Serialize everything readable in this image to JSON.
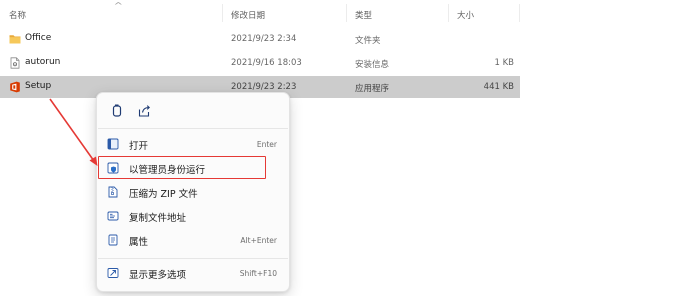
{
  "columns": {
    "name": "名称",
    "date": "修改日期",
    "type": "类型",
    "size": "大小"
  },
  "files": [
    {
      "icon": "folder-icon",
      "name": "Office",
      "date": "2021/9/23 2:34",
      "type": "文件夹",
      "size": ""
    },
    {
      "icon": "file-icon",
      "name": "autorun",
      "date": "2021/9/16 18:03",
      "type": "安装信息",
      "size": "1 KB"
    },
    {
      "icon": "office-app-icon",
      "name": "Setup",
      "date": "2021/9/23 2:23",
      "type": "应用程序",
      "size": "441 KB"
    }
  ],
  "context_menu": {
    "top_actions": [
      {
        "icon": "copy-icon"
      },
      {
        "icon": "share-icon"
      }
    ],
    "items": [
      {
        "icon": "open-icon",
        "label": "打开",
        "shortcut": "Enter"
      },
      {
        "icon": "shield-icon",
        "label": "以管理员身份运行",
        "shortcut": ""
      },
      {
        "icon": "zip-icon",
        "label": "压缩为 ZIP 文件",
        "shortcut": ""
      },
      {
        "icon": "copy-path-icon",
        "label": "复制文件地址",
        "shortcut": ""
      },
      {
        "icon": "properties-icon",
        "label": "属性",
        "shortcut": "Alt+Enter"
      },
      {
        "icon": "more-options-icon",
        "label": "显示更多选项",
        "shortcut": "Shift+F10"
      }
    ]
  },
  "annotation": {
    "color": "#e53935",
    "target": "以管理员身份运行"
  },
  "colors": {
    "selected_row": "#cccccc",
    "folder": "#f4c04e",
    "office_red": "#d83b01",
    "icon_blue": "#2b6fc7"
  }
}
